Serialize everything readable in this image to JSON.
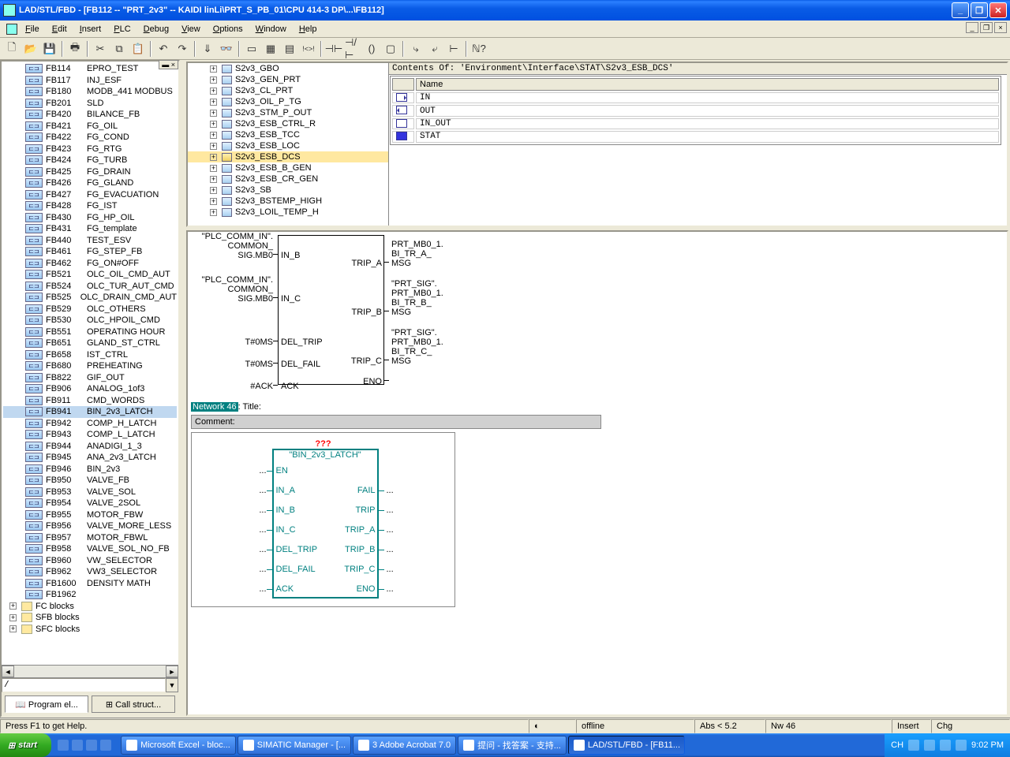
{
  "window": {
    "title": "LAD/STL/FBD  - [FB112 -- \"PRT_2v3\" -- KAIDI linLi\\PRT_S_PB_01\\CPU 414-3 DP\\...\\FB112]"
  },
  "menu": {
    "items": [
      "File",
      "Edit",
      "Insert",
      "PLC",
      "Debug",
      "View",
      "Options",
      "Window",
      "Help"
    ]
  },
  "left": {
    "tabs": {
      "a": "Program el...",
      "b": "Call struct..."
    },
    "cmd": "/",
    "blocks": [
      {
        "id": "FB114",
        "name": "EPRO_TEST"
      },
      {
        "id": "FB117",
        "name": "INJ_ESF"
      },
      {
        "id": "FB180",
        "name": "MODB_441  MODBUS"
      },
      {
        "id": "FB201",
        "name": "SLD"
      },
      {
        "id": "FB420",
        "name": "BILANCE_FB"
      },
      {
        "id": "FB421",
        "name": "FG_OIL"
      },
      {
        "id": "FB422",
        "name": "FG_COND"
      },
      {
        "id": "FB423",
        "name": "FG_RTG"
      },
      {
        "id": "FB424",
        "name": "FG_TURB"
      },
      {
        "id": "FB425",
        "name": "FG_DRAIN"
      },
      {
        "id": "FB426",
        "name": "FG_GLAND"
      },
      {
        "id": "FB427",
        "name": "FG_EVACUATION"
      },
      {
        "id": "FB428",
        "name": "FG_IST"
      },
      {
        "id": "FB430",
        "name": "FG_HP_OIL"
      },
      {
        "id": "FB431",
        "name": "FG_template"
      },
      {
        "id": "FB440",
        "name": "TEST_ESV"
      },
      {
        "id": "FB461",
        "name": "FG_STEP_FB"
      },
      {
        "id": "FB462",
        "name": "FG_ON#OFF"
      },
      {
        "id": "FB521",
        "name": "OLC_OIL_CMD_AUT"
      },
      {
        "id": "FB524",
        "name": "OLC_TUR_AUT_CMD"
      },
      {
        "id": "FB525",
        "name": "OLC_DRAIN_CMD_AUT"
      },
      {
        "id": "FB529",
        "name": "OLC_OTHERS"
      },
      {
        "id": "FB530",
        "name": "OLC_HPOIL_CMD"
      },
      {
        "id": "FB551",
        "name": "OPERATING HOUR"
      },
      {
        "id": "FB651",
        "name": "GLAND_ST_CTRL"
      },
      {
        "id": "FB658",
        "name": "IST_CTRL"
      },
      {
        "id": "FB680",
        "name": "PREHEATING"
      },
      {
        "id": "FB822",
        "name": "GIF_OUT"
      },
      {
        "id": "FB906",
        "name": "ANALOG_1of3"
      },
      {
        "id": "FB911",
        "name": "CMD_WORDS"
      },
      {
        "id": "FB941",
        "name": "BIN_2v3_LATCH",
        "sel": true
      },
      {
        "id": "FB942",
        "name": "COMP_H_LATCH"
      },
      {
        "id": "FB943",
        "name": "COMP_L_LATCH"
      },
      {
        "id": "FB944",
        "name": "ANADIGI_1_3"
      },
      {
        "id": "FB945",
        "name": "ANA_2v3_LATCH"
      },
      {
        "id": "FB946",
        "name": "BIN_2v3"
      },
      {
        "id": "FB950",
        "name": "VALVE_FB"
      },
      {
        "id": "FB953",
        "name": "VALVE_SOL"
      },
      {
        "id": "FB954",
        "name": "VALVE_2SOL"
      },
      {
        "id": "FB955",
        "name": "MOTOR_FBW"
      },
      {
        "id": "FB956",
        "name": "VALVE_MORE_LESS"
      },
      {
        "id": "FB957",
        "name": "MOTOR_FBWL"
      },
      {
        "id": "FB958",
        "name": "VALVE_SOL_NO_FB"
      },
      {
        "id": "FB960",
        "name": "VW_SELECTOR"
      },
      {
        "id": "FB962",
        "name": "VW3_SELECTOR"
      },
      {
        "id": "FB1600",
        "name": "DENSITY  MATH"
      },
      {
        "id": "FB1962",
        "name": ""
      }
    ],
    "groups": [
      "FC blocks",
      "SFB blocks",
      "SFC blocks"
    ]
  },
  "struct": {
    "items": [
      "S2v3_GBO",
      "S2v3_GEN_PRT",
      "S2v3_CL_PRT",
      "S2v3_OIL_P_TG",
      "S2v3_STM_P_OUT",
      "S2v3_ESB_CTRL_R",
      "S2v3_ESB_TCC",
      "S2v3_ESB_LOC",
      "S2v3_ESB_DCS",
      "S2v3_ESB_B_GEN",
      "S2v3_ESB_CR_GEN",
      "S2v3_SB",
      "S2v3_BSTEMP_HIGH",
      "S2v3_LOIL_TEMP_H"
    ],
    "selectedIndex": 8
  },
  "contents": {
    "header": "Contents Of: 'Environment\\Interface\\STAT\\S2v3_ESB_DCS'",
    "col": "Name",
    "rows": [
      "IN",
      "OUT",
      "IN_OUT",
      "STAT"
    ]
  },
  "fbd1": {
    "left": [
      {
        "sig": "\"PLC_COMM_IN\".\nCOMMON_\nSIG.MB0",
        "port": "IN_B"
      },
      {
        "sig": "\"PLC_COMM_IN\".\nCOMMON_\nSIG.MB0",
        "port": "IN_C"
      },
      {
        "sig": "T#0MS",
        "port": "DEL_TRIP"
      },
      {
        "sig": "T#0MS",
        "port": "DEL_FAIL"
      },
      {
        "sig": "#ACK",
        "port": "ACK"
      }
    ],
    "right": [
      {
        "port": "TRIP_A",
        "sig": "PRT_MB0_1.\nBI_TR_A_\nMSG"
      },
      {
        "port": "TRIP_B",
        "sig": "\"PRT_SIG\".\nPRT_MB0_1.\nBI_TR_B_\nMSG"
      },
      {
        "port": "TRIP_C",
        "sig": "\"PRT_SIG\".\nPRT_MB0_1.\nBI_TR_C_\nMSG"
      },
      {
        "port": "ENO",
        "sig": ""
      }
    ]
  },
  "net": {
    "label": "Network 46",
    "title": ": Title:",
    "comment": "Comment:",
    "err": "???"
  },
  "fbd2": {
    "name": "\"BIN_2v3_LATCH\"",
    "left": [
      "EN",
      "IN_A",
      "IN_B",
      "IN_C",
      "DEL_TRIP",
      "DEL_FAIL",
      "ACK"
    ],
    "right": [
      "",
      "FAIL",
      "TRIP",
      "TRIP_A",
      "TRIP_B",
      "TRIP_C",
      "ENO"
    ]
  },
  "status": {
    "help": "Press F1 to get Help.",
    "mode": "offline",
    "abs": "Abs < 5.2",
    "nw": "Nw 46",
    "ins": "Insert",
    "chg": "Chg"
  },
  "taskbar": {
    "start": "start",
    "tasks": [
      "Microsoft Excel - bloc...",
      "SIMATIC Manager - [...",
      "3 Adobe Acrobat 7.0",
      "提问 - 找答案 - 支持...",
      "LAD/STL/FBD  - [FB11..."
    ],
    "lang": "CH",
    "time": "9:02 PM"
  }
}
